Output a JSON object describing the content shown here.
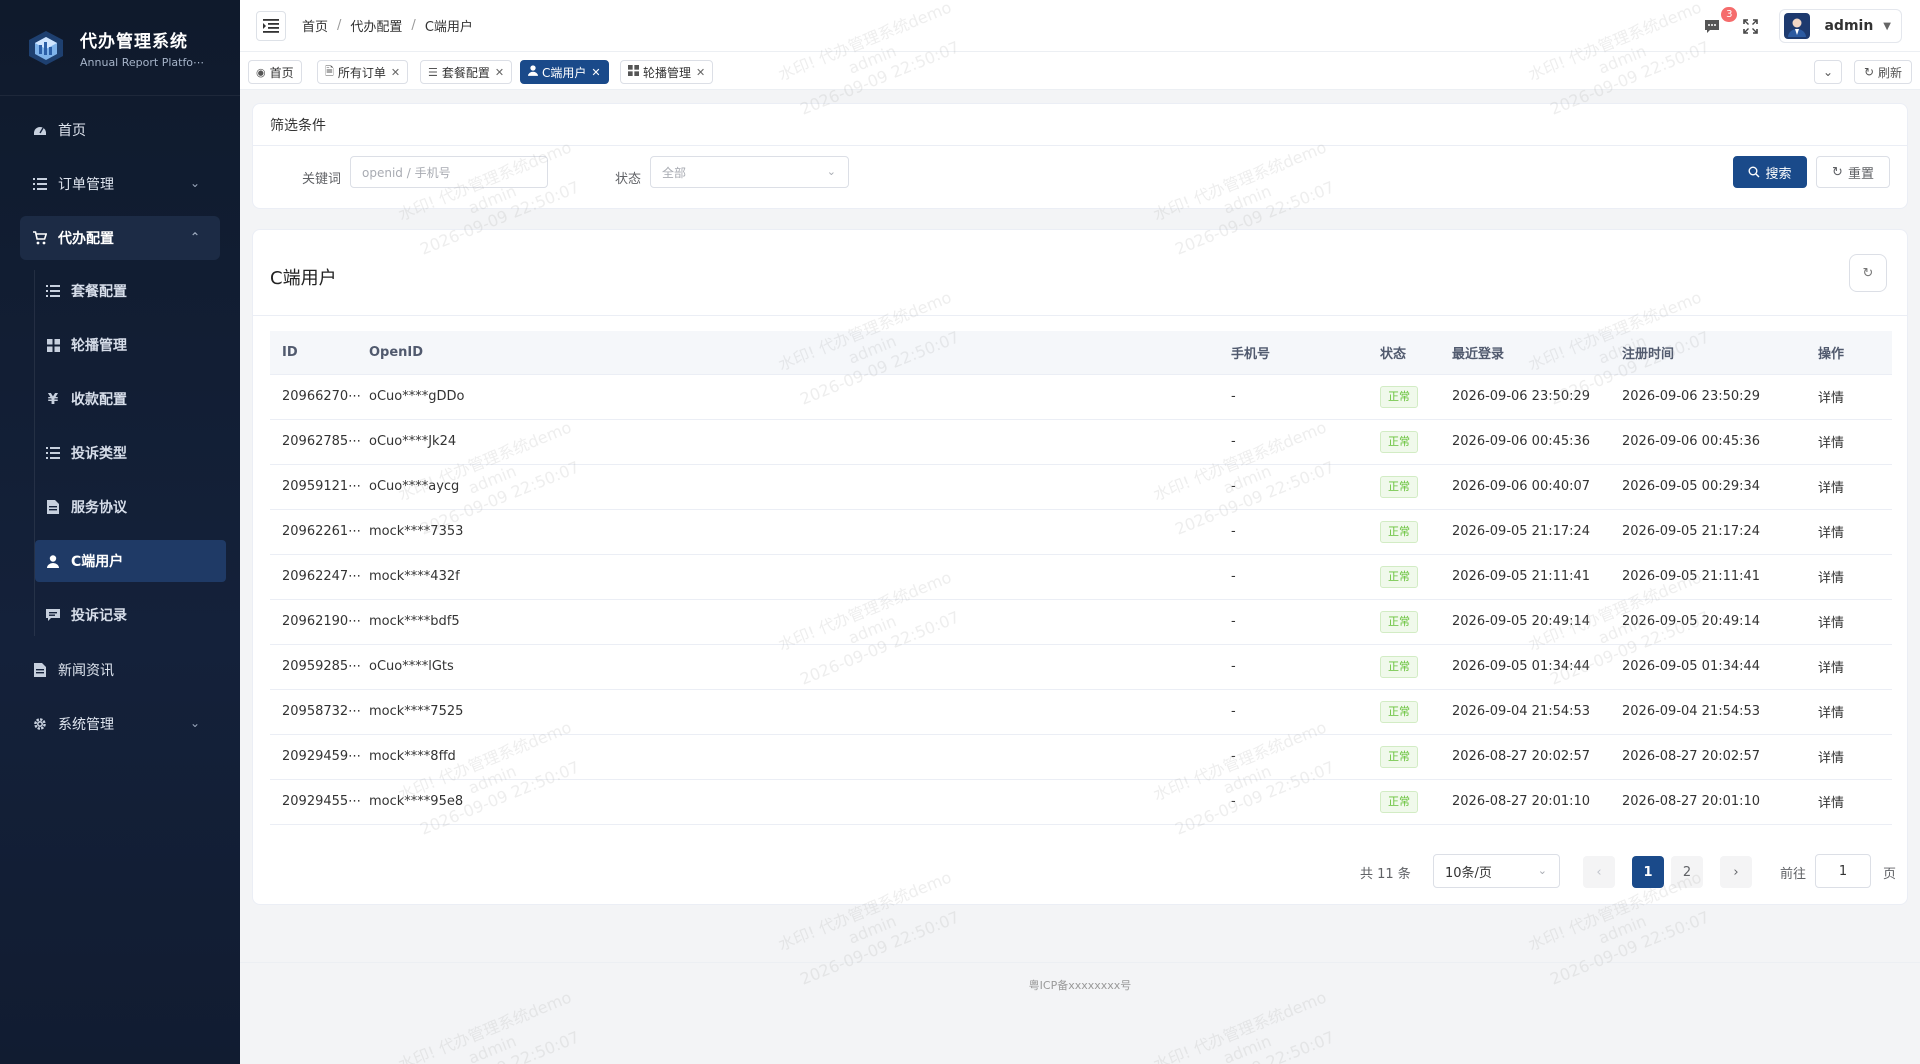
{
  "brand": {
    "title": "代办管理系统",
    "subtitle": "Annual Report Platfo⋯"
  },
  "sidebar": {
    "items": [
      {
        "label": "首页",
        "icon": "dashboard-icon"
      },
      {
        "label": "订单管理",
        "icon": "list-icon"
      },
      {
        "label": "代办配置",
        "icon": "cart-icon"
      },
      {
        "label": "新闻资讯",
        "icon": "document-icon"
      },
      {
        "label": "系统管理",
        "icon": "gear-icon"
      }
    ],
    "sub_items": [
      {
        "label": "套餐配置",
        "icon": "list-icon"
      },
      {
        "label": "轮播管理",
        "icon": "grid-icon"
      },
      {
        "label": "收款配置",
        "icon": "yen-icon"
      },
      {
        "label": "投诉类型",
        "icon": "list-icon"
      },
      {
        "label": "服务协议",
        "icon": "document-icon"
      },
      {
        "label": "C端用户",
        "icon": "user-icon"
      },
      {
        "label": "投诉记录",
        "icon": "chat-icon"
      }
    ]
  },
  "header": {
    "breadcrumb": [
      "首页",
      "代办配置",
      "C端用户"
    ],
    "message_count": "3",
    "username": "admin"
  },
  "tabs": [
    {
      "label": "首页"
    },
    {
      "label": "所有订单"
    },
    {
      "label": "套餐配置"
    },
    {
      "label": "C端用户"
    },
    {
      "label": "轮播管理"
    }
  ],
  "tabs_refresh": "刷新",
  "filter": {
    "title": "筛选条件",
    "keyword_label": "关键词",
    "keyword_placeholder": "openid / 手机号",
    "status_label": "状态",
    "status_value": "全部",
    "search_label": "搜索",
    "reset_label": "重置"
  },
  "list": {
    "title": "C端用户",
    "columns": [
      "ID",
      "OpenID",
      "手机号",
      "状态",
      "最近登录",
      "注册时间",
      "操作"
    ],
    "rows": [
      {
        "id": "20966270⋯",
        "openid": "oCuo****gDDo",
        "phone": "-",
        "status": "正常",
        "last_login": "2026-09-06 23:50:29",
        "registered": "2026-09-06 23:50:29",
        "op": "详情"
      },
      {
        "id": "20962785⋯",
        "openid": "oCuo****Jk24",
        "phone": "-",
        "status": "正常",
        "last_login": "2026-09-06 00:45:36",
        "registered": "2026-09-06 00:45:36",
        "op": "详情"
      },
      {
        "id": "20959121⋯",
        "openid": "oCuo****aycg",
        "phone": "-",
        "status": "正常",
        "last_login": "2026-09-06 00:40:07",
        "registered": "2026-09-05 00:29:34",
        "op": "详情"
      },
      {
        "id": "20962261⋯",
        "openid": "mock****7353",
        "phone": "-",
        "status": "正常",
        "last_login": "2026-09-05 21:17:24",
        "registered": "2026-09-05 21:17:24",
        "op": "详情"
      },
      {
        "id": "20962247⋯",
        "openid": "mock****432f",
        "phone": "-",
        "status": "正常",
        "last_login": "2026-09-05 21:11:41",
        "registered": "2026-09-05 21:11:41",
        "op": "详情"
      },
      {
        "id": "20962190⋯",
        "openid": "mock****bdf5",
        "phone": "-",
        "status": "正常",
        "last_login": "2026-09-05 20:49:14",
        "registered": "2026-09-05 20:49:14",
        "op": "详情"
      },
      {
        "id": "20959285⋯",
        "openid": "oCuo****lGts",
        "phone": "-",
        "status": "正常",
        "last_login": "2026-09-05 01:34:44",
        "registered": "2026-09-05 01:34:44",
        "op": "详情"
      },
      {
        "id": "20958732⋯",
        "openid": "mock****7525",
        "phone": "-",
        "status": "正常",
        "last_login": "2026-09-04 21:54:53",
        "registered": "2026-09-04 21:54:53",
        "op": "详情"
      },
      {
        "id": "20929459⋯",
        "openid": "mock****8ffd",
        "phone": "-",
        "status": "正常",
        "last_login": "2026-08-27 20:02:57",
        "registered": "2026-08-27 20:02:57",
        "op": "详情"
      },
      {
        "id": "20929455⋯",
        "openid": "mock****95e8",
        "phone": "-",
        "status": "正常",
        "last_login": "2026-08-27 20:01:10",
        "registered": "2026-08-27 20:01:10",
        "op": "详情"
      }
    ]
  },
  "pagination": {
    "total": "共 11 条",
    "page_size": "10条/页",
    "pages": [
      "1",
      "2"
    ],
    "current": "1",
    "goto_label": "前往",
    "goto_value": "1",
    "goto_unit": "页"
  },
  "footer": {
    "icp": "粤ICP备xxxxxxxx号"
  },
  "watermark": {
    "line1": "水印! 代办管理系统demo",
    "line2": "admin",
    "line3": "2026-09-09 22:50:07"
  },
  "colors": {
    "primary": "#1a4a8a",
    "sidebar_bg": "#0f1a2c",
    "success": "#67c23a",
    "badge": "#f56c6c"
  }
}
